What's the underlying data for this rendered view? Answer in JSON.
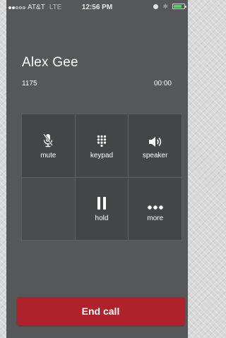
{
  "status_bar": {
    "carrier": "AT&T",
    "network": "LTE",
    "time": "12:56 PM",
    "signal_bars_filled": 2,
    "signal_bars_total": 5,
    "battery_level": 0.75,
    "icons": [
      "signal-dots-icon",
      "alarm-icon",
      "bluetooth-icon",
      "battery-icon"
    ]
  },
  "call": {
    "caller_name": "Alex Gee",
    "extension": "1175",
    "duration": "00:00"
  },
  "controls": {
    "mute_label": "mute",
    "keypad_label": "keypad",
    "speaker_label": "speaker",
    "hold_label": "hold",
    "more_label": "more"
  },
  "end_call_label": "End call",
  "colors": {
    "background": "#555759",
    "cell": "#434547",
    "end_call": "#b0222b",
    "battery": "#4cd964"
  }
}
